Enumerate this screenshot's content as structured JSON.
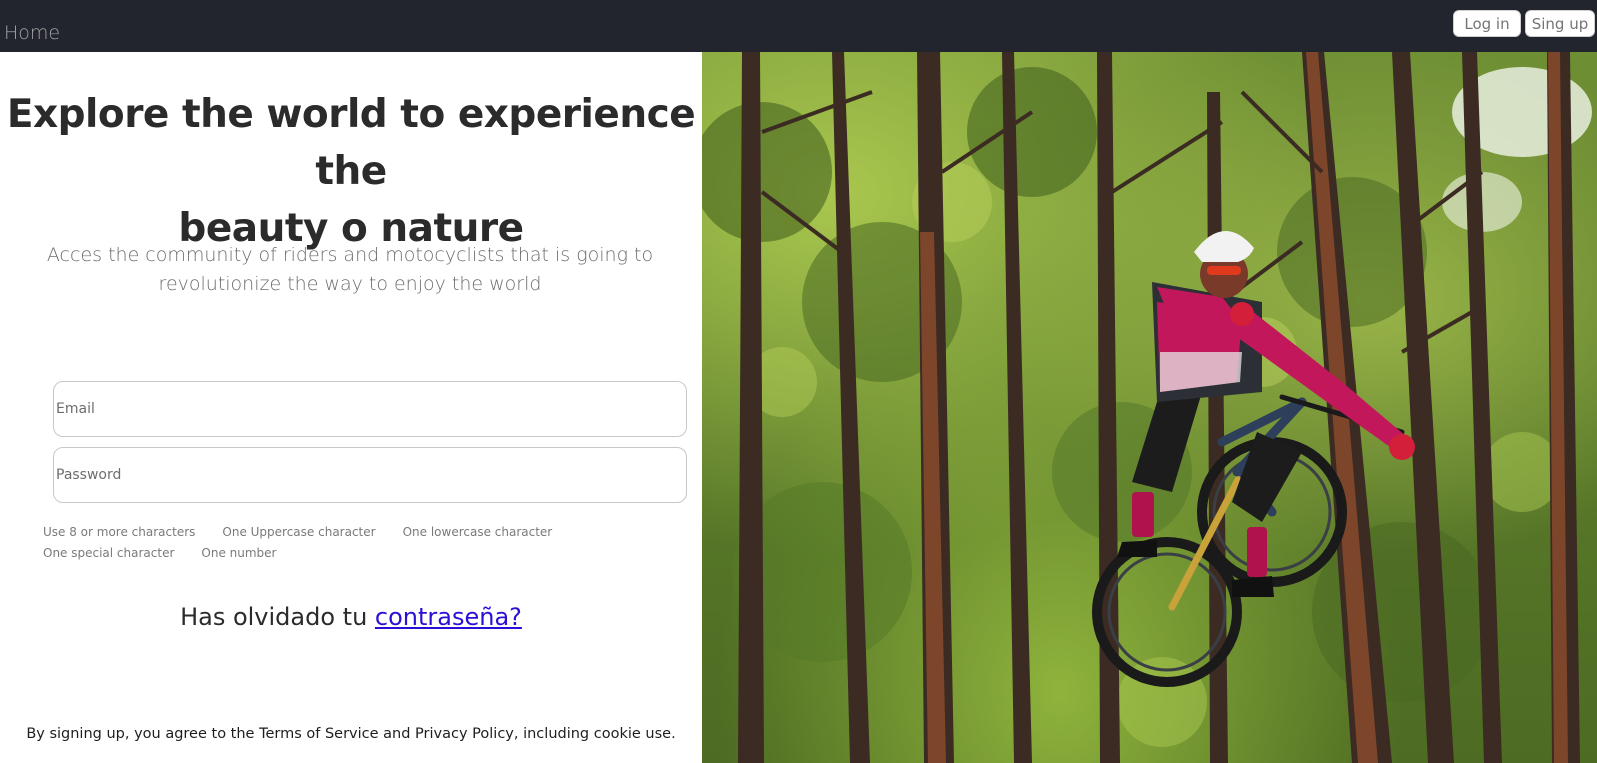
{
  "nav": {
    "home_label": "Home",
    "login_label": "Log in",
    "signup_label": "Sing up"
  },
  "hero": {
    "headline_line1": "Explore the world to experience the",
    "headline_line2": "beauty o nature",
    "subline_line1": "Acces the community of riders and motocyclists that is going to",
    "subline_line2": "revolutionize the way to enjoy the world"
  },
  "form": {
    "email_placeholder": "Email",
    "password_placeholder": "Password",
    "password_rules": [
      "Use 8 or more characters",
      "One Uppercase character",
      "One lowercase character",
      "One special character",
      "One number"
    ],
    "forgot_prefix": "Has olvidado tu ",
    "forgot_link": "contraseña?"
  },
  "footer": {
    "terms": "By signing up, you agree to the Terms of Service and Privacy Policy, including cookie use."
  },
  "colors": {
    "nav_background": "#22252e",
    "link": "#2a0fd6",
    "rider_jersey": "#c2185b"
  }
}
